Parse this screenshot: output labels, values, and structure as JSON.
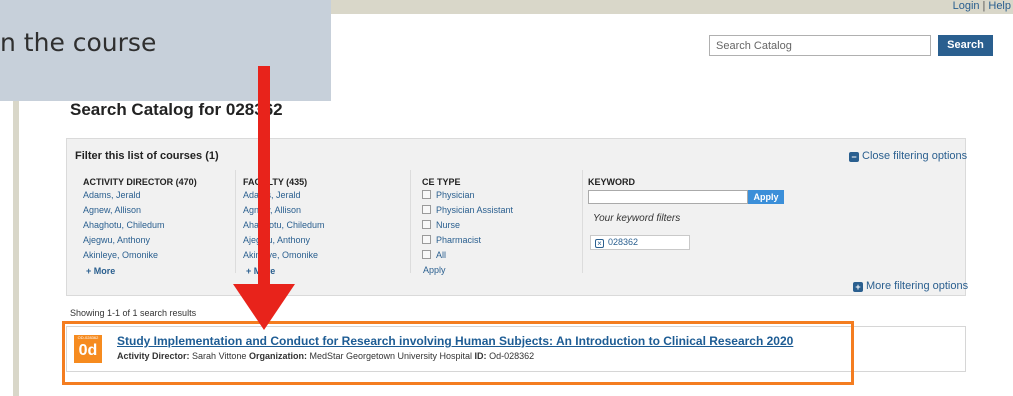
{
  "banner": {
    "text": "n the course"
  },
  "top_links": {
    "login": "Login",
    "separator": "|",
    "help": "Help"
  },
  "search": {
    "placeholder": "Search Catalog",
    "button_label": "Search"
  },
  "page_title": "Search Catalog for 028362",
  "filter": {
    "title": "Filter this list of courses (1)",
    "close_label": "Close filtering options",
    "more_label": "More filtering options",
    "activity_director": {
      "heading": "ACTIVITY DIRECTOR (470)",
      "items": [
        "Adams, Jerald",
        "Agnew, Allison",
        "Ahaghotu, Chiledum",
        "Ajegwu, Anthony",
        "Akinleye, Omonike"
      ],
      "more": "+ More"
    },
    "faculty": {
      "heading": "FACULTY (435)",
      "items": [
        "Adams, Jerald",
        "Agnew, Allison",
        "Ahaghotu, Chiledum",
        "Ajegwu, Anthony",
        "Akinleye, Omonike"
      ],
      "more": "+ More"
    },
    "ce_type": {
      "heading": "CE TYPE",
      "items": [
        "Physician",
        "Physician Assistant",
        "Nurse",
        "Pharmacist",
        "All"
      ],
      "apply": "Apply"
    },
    "keyword": {
      "heading": "KEYWORD",
      "value": "",
      "apply": "Apply",
      "filters_label": "Your keyword filters",
      "chips": [
        "028362"
      ]
    }
  },
  "results": {
    "count_text": "Showing 1-1 of 1 search results",
    "items": [
      {
        "badge_top": "OD-028362",
        "badge": "0d",
        "title": "Study Implementation and Conduct for Research involving Human Subjects: An Introduction to Clinical Research 2020",
        "director_label": "Activity Director:",
        "director": "Sarah Vittone",
        "org_label": "Organization:",
        "org": "MedStar Georgetown University Hospital",
        "id_label": "ID:",
        "id": "Od-028362"
      }
    ]
  },
  "colors": {
    "link": "#2a5f8f",
    "search_button": "#2a5f8f",
    "apply_button": "#3b8fd9",
    "badge": "#f68b1f",
    "highlight": "#f47d20",
    "arrow": "#e8231b",
    "banner_bg": "#c7d0da"
  }
}
